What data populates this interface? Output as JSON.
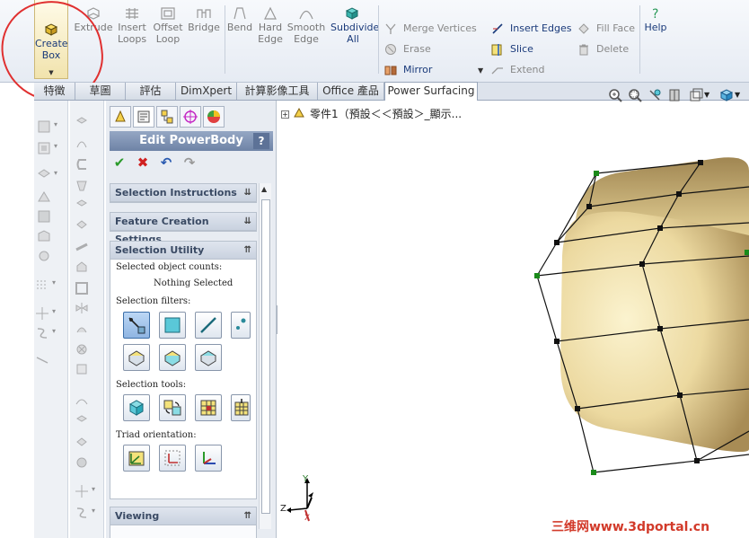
{
  "ribbon": {
    "create_box": {
      "line1": "Create",
      "line2": "Box"
    },
    "buttons": [
      {
        "id": "extrude",
        "line1": "Extrude",
        "line2": ""
      },
      {
        "id": "insert-loops",
        "line1": "Insert",
        "line2": "Loops"
      },
      {
        "id": "offset-loop",
        "line1": "Offset",
        "line2": "Loop"
      },
      {
        "id": "bridge",
        "line1": "Bridge",
        "line2": ""
      },
      {
        "id": "bend",
        "line1": "Bend",
        "line2": ""
      },
      {
        "id": "hard-edge",
        "line1": "Hard",
        "line2": "Edge"
      },
      {
        "id": "smooth-edge",
        "line1": "Smooth",
        "line2": "Edge"
      },
      {
        "id": "subdivide-all",
        "line1": "Subdivide",
        "line2": "All"
      }
    ],
    "small_col1": [
      "Merge Vertices",
      "Erase",
      "Mirror"
    ],
    "small_col2": [
      "Insert Edges",
      "Slice",
      "Extend"
    ],
    "small_col3": [
      "Fill Face",
      "Delete"
    ],
    "help": "Help"
  },
  "tabs": [
    "特徵",
    "草圖",
    "評估",
    "DimXpert",
    "計算影像工具",
    "Office 產品",
    "Power Surfacing"
  ],
  "panel": {
    "title": "Edit PowerBody",
    "help": "?",
    "groups": {
      "selection_instructions": "Selection Instructions",
      "feature_creation_settings": "Feature Creation Settings",
      "selection_utility": "Selection Utility",
      "viewing": "Viewing"
    },
    "selected_object_counts": "Selected object counts:",
    "nothing_selected": "Nothing Selected",
    "selection_filters": "Selection filters:",
    "selection_tools": "Selection tools:",
    "triad_orientation": "Triad orientation:"
  },
  "viewport": {
    "tree_item": "零件1（預設＜＜預設＞_顯示..."
  },
  "triad": {
    "x": "X",
    "y": "Y",
    "z": "Z"
  },
  "watermark": "三维网www.3dportal.cn"
}
